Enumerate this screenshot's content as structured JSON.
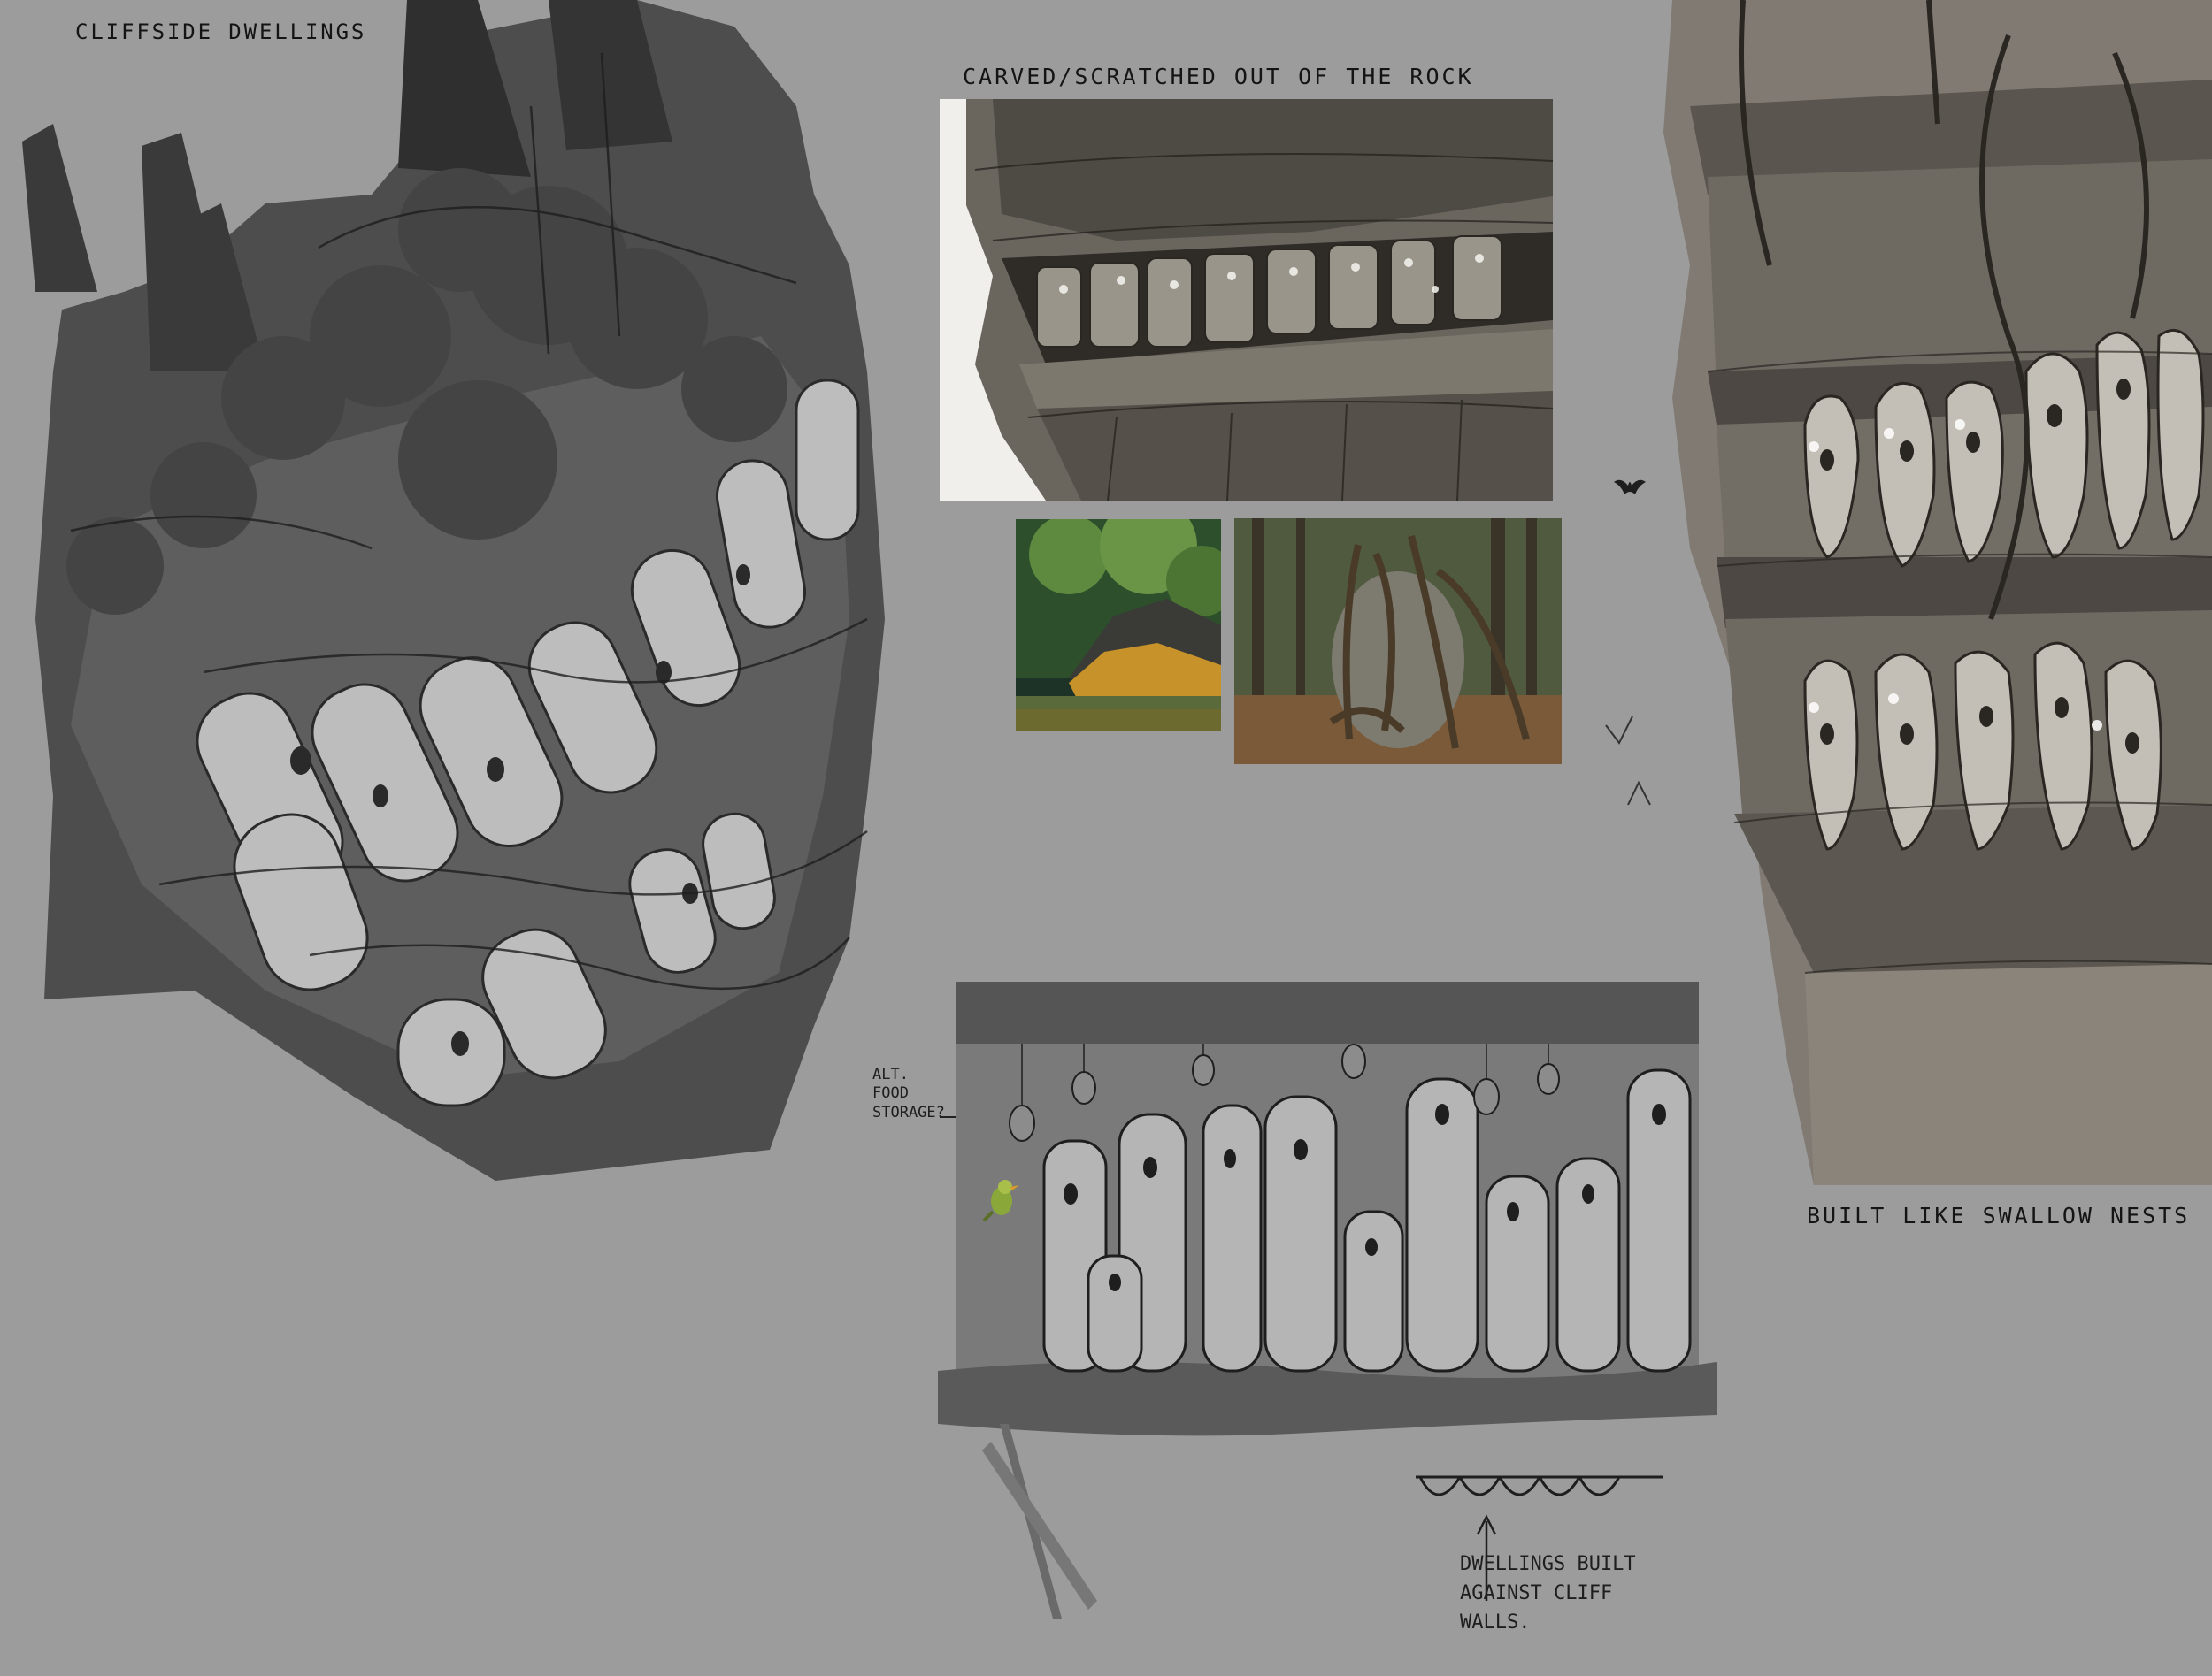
{
  "labels": {
    "cliffside": "CLIFFSIDE DWELLINGS",
    "carved": "CARVED/SCRATCHED OUT OF THE ROCK",
    "swallow": "BUILT LIKE SWALLOW NESTS",
    "food_storage": "ALT.\nFOOD\nSTORAGE?",
    "dwellings_built": "DWELLINGS BUILT\nAGAINST CLIFF\nWALLS."
  },
  "colors": {
    "canvas": "#9c9c9c",
    "ink": "#141414",
    "rock_dark": "#4a4a4a",
    "rock_mid": "#6e6e6e",
    "pod_light": "#c8c8c8",
    "sepia_rock": "#5f5a52",
    "photo_foliage": "#4f7a36",
    "photo_moss": "#c8922a",
    "photo_water": "#3a5a3c",
    "photo_forest": "#6b5a3e"
  },
  "artworks": {
    "sketch_left": "cliffside-dwellings-sketch",
    "sketch_carved": "carved-rock-painting",
    "photo_lake": "mossy-rock-lake-photo",
    "photo_roots": "tree-roots-boulder-photo",
    "sketch_right": "swallow-nest-cliff-sketch",
    "sketch_bottom": "cliff-wall-dwellings-sketch",
    "bird_icon": "bat-icon",
    "small_bird": "green-bird-figure"
  }
}
